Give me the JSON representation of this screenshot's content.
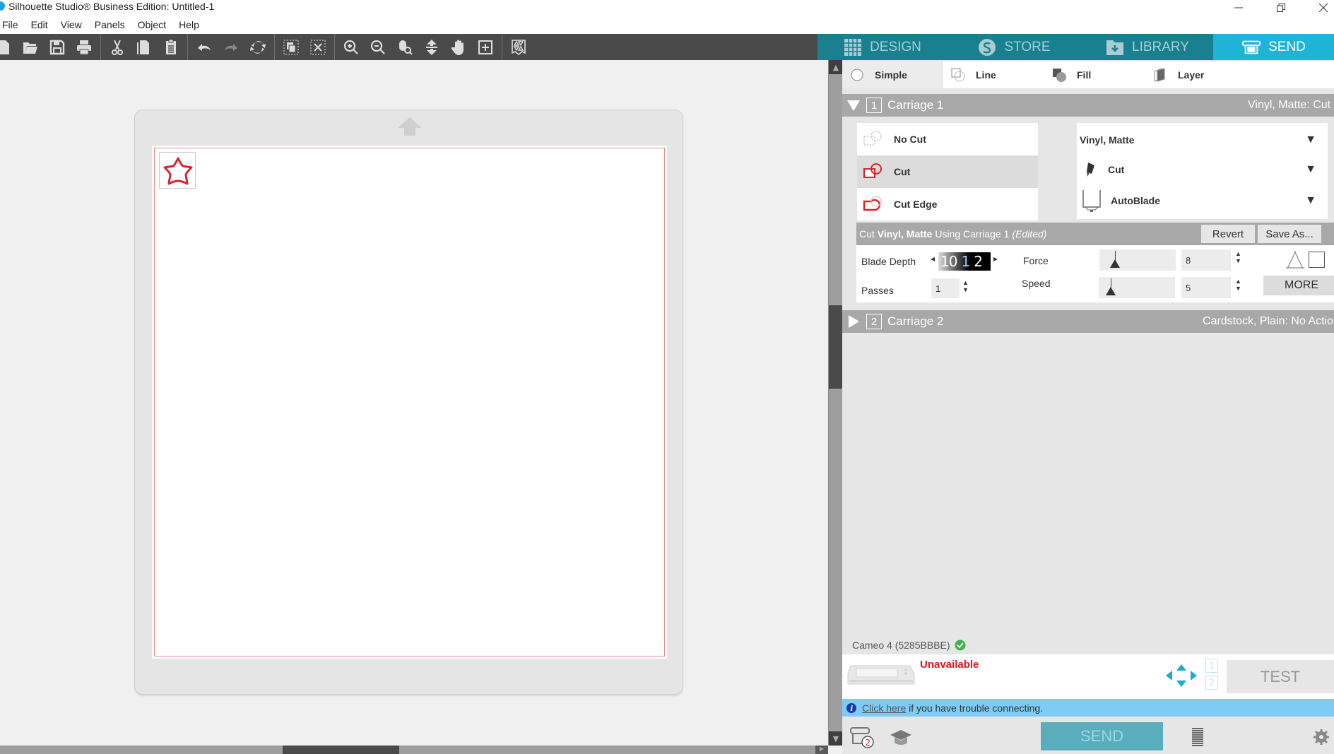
{
  "window": {
    "title": "Silhouette Studio® Business Edition: Untitled-1",
    "controls": [
      "minimize",
      "restore",
      "close"
    ]
  },
  "menu": [
    "File",
    "Edit",
    "View",
    "Panels",
    "Object",
    "Help"
  ],
  "toolbar": {
    "groups": [
      [
        "new-document",
        "open-folder",
        "save",
        "print"
      ],
      [
        "cut",
        "copy",
        "paste"
      ],
      [
        "undo",
        "redo",
        "redraw"
      ],
      [
        "select-all",
        "deselect"
      ],
      [
        "zoom-in",
        "zoom-out",
        "zoom-selection",
        "pan-down",
        "pan-hand",
        "fit-to-page"
      ],
      [
        "nest"
      ]
    ]
  },
  "nav": {
    "tabs": [
      {
        "label": "DESIGN",
        "icon": "grid-icon"
      },
      {
        "label": "STORE",
        "icon": "silhouette-s-icon"
      },
      {
        "label": "LIBRARY",
        "icon": "library-download-icon"
      },
      {
        "label": "SEND",
        "icon": "cutter-icon",
        "active": true
      }
    ]
  },
  "modes": {
    "items": [
      {
        "label": "Simple",
        "active": true
      },
      {
        "label": "Line"
      },
      {
        "label": "Fill"
      },
      {
        "label": "Layer"
      }
    ]
  },
  "carriage1": {
    "number": "1",
    "label": "Carriage 1",
    "summary": "Vinyl, Matte: Cut",
    "actions": [
      {
        "label": "No Cut"
      },
      {
        "label": "Cut",
        "active": true
      },
      {
        "label": "Cut Edge"
      }
    ],
    "material": "Vinyl, Matte",
    "action": "Cut",
    "tool": "AutoBlade",
    "settings_bar": {
      "prefix": "Cut",
      "material": "Vinyl, Matte",
      "middle": "Using Carriage 1",
      "state": "(Edited)",
      "revert": "Revert",
      "save_as": "Save As..."
    },
    "params": {
      "blade_depth_label": "Blade Depth",
      "blade_depth_digits": [
        "10",
        "1",
        "2"
      ],
      "passes_label": "Passes",
      "passes": "1",
      "force_label": "Force",
      "force": "8",
      "force_fraction": 0.07,
      "speed_label": "Speed",
      "speed": "5",
      "speed_fraction": 0.03,
      "more": "MORE"
    }
  },
  "carriage2": {
    "number": "2",
    "label": "Carriage 2",
    "summary": "Cardstock, Plain: No Action"
  },
  "device": {
    "name": "Cameo 4 (5285BBBE)",
    "status": "Unavailable",
    "carriage_indicators": [
      "1",
      "2"
    ],
    "test": "TEST",
    "info_link": "Click here",
    "info_text": "if you have trouble connecting.",
    "send": "SEND"
  },
  "colors": {
    "accent": "#1fb3d5",
    "nav_bg": "#1a7f8f",
    "cut_red": "#e0161e",
    "toolbar_bg": "#4a4a4a"
  }
}
